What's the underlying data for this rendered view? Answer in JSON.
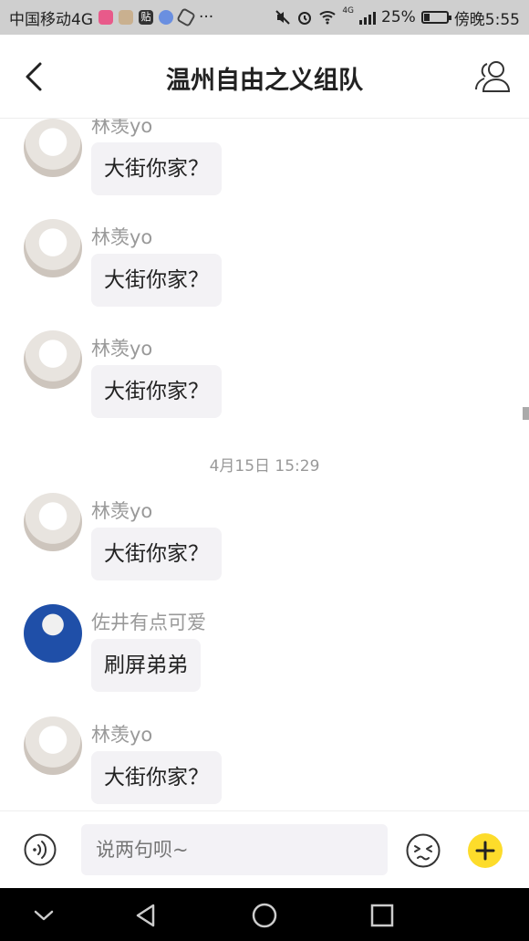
{
  "status_bar": {
    "carrier": "中国移动4G",
    "tie_icon": "贴",
    "more": "···",
    "network": "4G",
    "battery_percent": "25%",
    "battery_level": 0.25,
    "time": "傍晚5:55"
  },
  "header": {
    "title": "温州自由之义组队"
  },
  "messages": [
    {
      "sender": "林羡yo",
      "text": "大街你家？",
      "avatar": "anime"
    },
    {
      "sender": "林羡yo",
      "text": "大街你家？",
      "avatar": "anime"
    },
    {
      "sender": "林羡yo",
      "text": "大街你家？",
      "avatar": "anime"
    },
    {
      "sender": "林羡yo",
      "text": "大街你家？",
      "avatar": "anime"
    },
    {
      "sender": "佐井有点可爱",
      "text": "刷屏弟弟",
      "avatar": "blue"
    },
    {
      "sender": "林羡yo",
      "text": "大街你家？",
      "avatar": "anime"
    }
  ],
  "timestamp": "4月15日 15:29",
  "input": {
    "placeholder": "说两句呗~"
  },
  "icons": {
    "back": "chevron-left-icon",
    "members": "group-members-icon",
    "voice": "voice-icon",
    "emoji": "emoji-icon",
    "plus": "plus-icon"
  },
  "colors": {
    "accent_yellow": "#fddc2b",
    "bubble_bg": "#f3f2f5",
    "sender_gray": "#999999"
  }
}
